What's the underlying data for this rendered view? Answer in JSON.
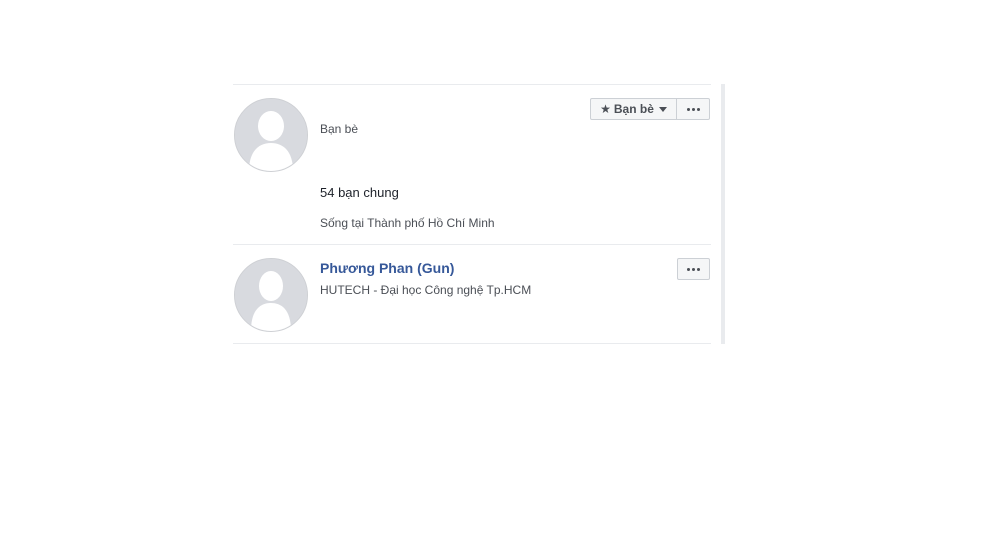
{
  "cards": [
    {
      "relation": "Bạn bè",
      "mutual_friends": "54 bạn chung",
      "lives_in": "Sống tại Thành phố Hồ Chí Minh",
      "friend_button": {
        "label": "Bạn bè",
        "icon": "star-icon"
      }
    },
    {
      "name": "Phương Phan (Gun)",
      "subtitle": "HUTECH - Đại học Công nghệ Tp.HCM"
    }
  ],
  "colors": {
    "link": "#365899",
    "secondary_text": "#4b4f56",
    "divider": "#e9ebee",
    "avatar_bg": "#d8dadf"
  }
}
